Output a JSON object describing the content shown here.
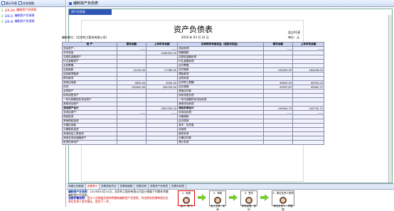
{
  "left": {
    "tab1": "图示列表",
    "tab2": "任务视图",
    "tasks": [
      {
        "num": "1",
        "code": "(20.24)",
        "label": "编制资产负债表"
      },
      {
        "num": "2",
        "code": "(20.1)",
        "label": "编制资产负债表"
      },
      {
        "num": "3",
        "code": "(20.4)",
        "label": "编制资产负债表"
      }
    ]
  },
  "main": {
    "header": "编制资产负债表",
    "sheet_tab": "资产负债表",
    "doc": {
      "title": "资产负债表",
      "form_no": "会企01表",
      "company": "编制单位：(北京科工股份有限公司)",
      "date": "2019 年 03 月 31 日",
      "unit": "单位：元",
      "headers": [
        "资 产",
        "期末余额",
        "上年年末余额",
        "负债和所有者权益（或股东权益）",
        "期末余额",
        "上年年末余额"
      ],
      "rows": [
        [
          "流动资产：",
          "——",
          "——",
          "流动负债：",
          "——",
          "——"
        ],
        [
          "货币资金",
          "",
          "2440555.20",
          "短期借款",
          "",
          ""
        ],
        [
          "交易性金融资产",
          "",
          "",
          "交易性金融负债",
          "",
          ""
        ],
        [
          "衍生金融资产",
          "",
          "",
          "衍生金融负债",
          "",
          ""
        ],
        [
          "应收票据",
          "",
          "",
          "应付票据",
          "",
          ""
        ],
        [
          "应收账款",
          "12234.00",
          "17780.00",
          "应付账款",
          "120000.00",
          "184436.00"
        ],
        [
          "应收款项融资",
          "",
          "",
          "预收款项",
          "",
          ""
        ],
        [
          "预付款项",
          "",
          "",
          "合同负债",
          "",
          ""
        ],
        [
          "其他应收款",
          "3650.00",
          "4000.00",
          "应付职工薪酬",
          "49890.00",
          "90952.00"
        ],
        [
          "存货",
          "130000.00",
          "189700.00",
          "应交税费",
          "20997.87",
          "43062.72"
        ],
        [
          "合同资产",
          "",
          "",
          "其他应付款",
          "",
          ""
        ],
        [
          "持有待售资产",
          "",
          "",
          "持有待售负债",
          "",
          ""
        ],
        [
          "一年内到期的非流动资产",
          "",
          "",
          "一年内到期的非流动负债",
          "",
          ""
        ],
        [
          "其他流动资产",
          "",
          "",
          "其他流动负债",
          "",
          ""
        ],
        [
          "流动资产合计",
          "",
          "2651935.20",
          "流动负债合计",
          "190904.73",
          "245790.72"
        ],
        [
          "非流动资产：",
          "——",
          "——",
          "非流动负债：",
          "——",
          "——"
        ],
        [
          "债权投资",
          "",
          "",
          "长期借款",
          "",
          ""
        ],
        [
          "其他债权投资",
          "",
          "",
          "应付债券",
          "",
          ""
        ],
        [
          "长期应收款",
          "",
          "",
          "其中：优先股",
          "",
          ""
        ],
        [
          "长期股权投资",
          "",
          "",
          "永续债",
          "",
          ""
        ],
        [
          "其他权益工具投资",
          "",
          "",
          "租赁负债",
          "",
          ""
        ],
        [
          "其他非流动金融资产",
          "",
          "",
          "长期应付款",
          "",
          ""
        ],
        [
          "投资性房地产",
          "",
          "",
          "预计负债",
          "",
          ""
        ]
      ],
      "bold_rows": [
        14
      ]
    }
  },
  "bottom": {
    "tabs": [
      "明细业务数据",
      "查看提示",
      "查看原始凭证",
      "查看明细账",
      "查看总账",
      "查看资产负债表",
      "查看利润表"
    ],
    "active_tab": 1,
    "desc_head": "编制资产负债表：",
    "desc_body": "2019年03月31日，北京科工股份有限公司会计根据下列期末余额编制资产负债表。",
    "desc_tip_label": "当前步骤说明：",
    "desc_tip": "会计人员根据总账和明细账编制资产负债表，并由财务经理审核后交单位负责人签字确认，提交下一步。",
    "steps": [
      {
        "title": "1：制表",
        "caption": "会计：陈飞"
      },
      {
        "title": "2：审核",
        "caption": "会计主管：吴海"
      },
      {
        "title": "3：签字",
        "caption": "财务经理：张欣"
      },
      {
        "title": "4：单位负责人签章",
        "caption": "单位负责人：李建国"
      }
    ]
  }
}
